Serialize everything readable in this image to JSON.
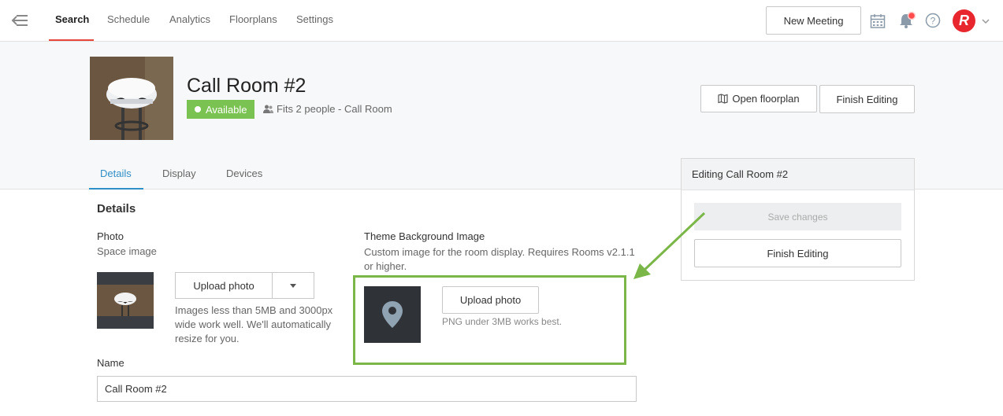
{
  "nav": {
    "links": [
      "Search",
      "Schedule",
      "Analytics",
      "Floorplans",
      "Settings"
    ],
    "new_meeting": "New Meeting",
    "avatar_letter": "R",
    "accent": "#e8463a"
  },
  "room": {
    "title": "Call Room #2",
    "status": "Available",
    "status_color": "#7ac251",
    "capacity": "Fits 2 people - Call Room",
    "open_floorplan": "Open floorplan",
    "finish_editing": "Finish Editing"
  },
  "tabs": [
    "Details",
    "Display",
    "Devices"
  ],
  "details": {
    "heading": "Details",
    "photo": {
      "label": "Photo",
      "sublabel": "Space image",
      "upload": "Upload photo",
      "hint_lines": [
        "Images less than 5MB and 3000px",
        "wide work well. We'll automatically",
        "resize for you."
      ]
    },
    "theme": {
      "label": "Theme Background Image",
      "desc_lines": [
        "Custom image for the room display. Requires Rooms v2.1.1",
        "or higher."
      ],
      "upload": "Upload photo",
      "hint": "PNG under 3MB works best."
    },
    "name": {
      "label": "Name",
      "value": "Call Room #2"
    }
  },
  "edit_panel": {
    "title": "Editing Call Room #2",
    "save": "Save changes",
    "finish": "Finish Editing"
  },
  "highlight_color": "#7ab648"
}
